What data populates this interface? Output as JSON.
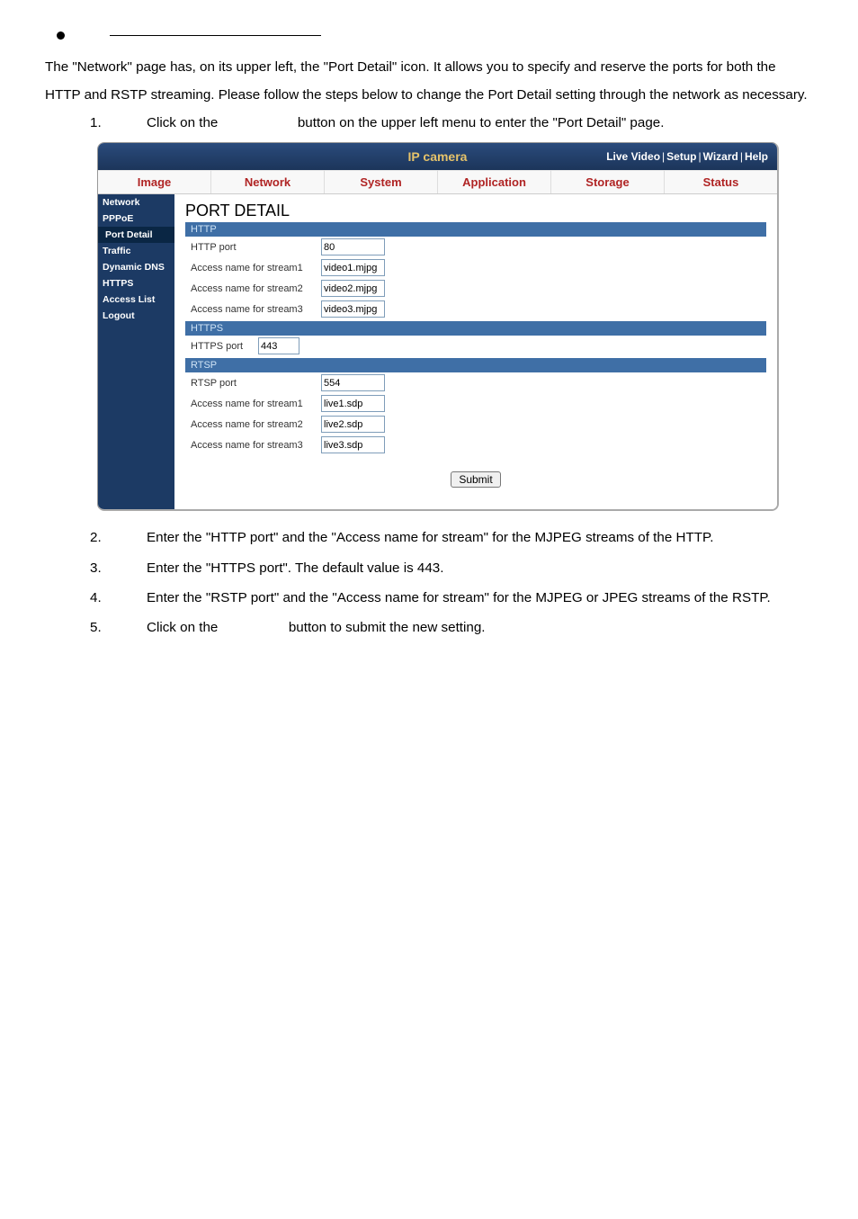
{
  "intro_text": "The \"Network\" page has, on its upper left, the \"Port Detail\" icon. It allows you to specify and reserve the ports for both the HTTP and RSTP streaming. Please follow the steps below to change the Port Detail setting through the network as necessary.",
  "steps": {
    "s1a": "Click on the",
    "s1b": "button on the upper left menu to enter the \"Port Detail\" page.",
    "s2": "Enter the \"HTTP port\" and the \"Access name for stream\" for the MJPEG streams of the HTTP.",
    "s3": "Enter the \"HTTPS port\". The default value is 443.",
    "s4": "Enter the \"RSTP port\" and the \"Access name for stream\" for the MJPEG or JPEG streams of the RSTP.",
    "s5a": "Click on the",
    "s5b": "button to submit the new setting."
  },
  "ui": {
    "header_title": "IP camera",
    "links": {
      "live": "Live Video",
      "setup": "Setup",
      "wizard": "Wizard",
      "help": "Help",
      "sep": "|"
    },
    "tabs": {
      "image": "Image",
      "network": "Network",
      "system": "System",
      "application": "Application",
      "storage": "Storage",
      "status": "Status"
    },
    "sidebar": {
      "network": "Network",
      "pppoe": "PPPoE",
      "portdetail": "Port Detail",
      "traffic": "Traffic",
      "ddns": "Dynamic DNS",
      "https": "HTTPS",
      "accesslist": "Access List",
      "logout": "Logout"
    },
    "content": {
      "title": "PORT DETAIL",
      "http_hdr": "HTTP",
      "http_port_label": "HTTP port",
      "http_port_value": "80",
      "an1_label": "Access name for stream1",
      "an1_value": "video1.mjpg",
      "an2_label": "Access name for stream2",
      "an2_value": "video2.mjpg",
      "an3_label": "Access name for stream3",
      "an3_value": "video3.mjpg",
      "https_hdr": "HTTPS",
      "https_port_label": "HTTPS port",
      "https_port_value": "443",
      "rtsp_hdr": "RTSP",
      "rtsp_port_label": "RTSP port",
      "rtsp_port_value": "554",
      "r1_label": "Access name for stream1",
      "r1_value": "live1.sdp",
      "r2_label": "Access name for stream2",
      "r2_value": "live2.sdp",
      "r3_label": "Access name for stream3",
      "r3_value": "live3.sdp",
      "submit": "Submit"
    }
  }
}
